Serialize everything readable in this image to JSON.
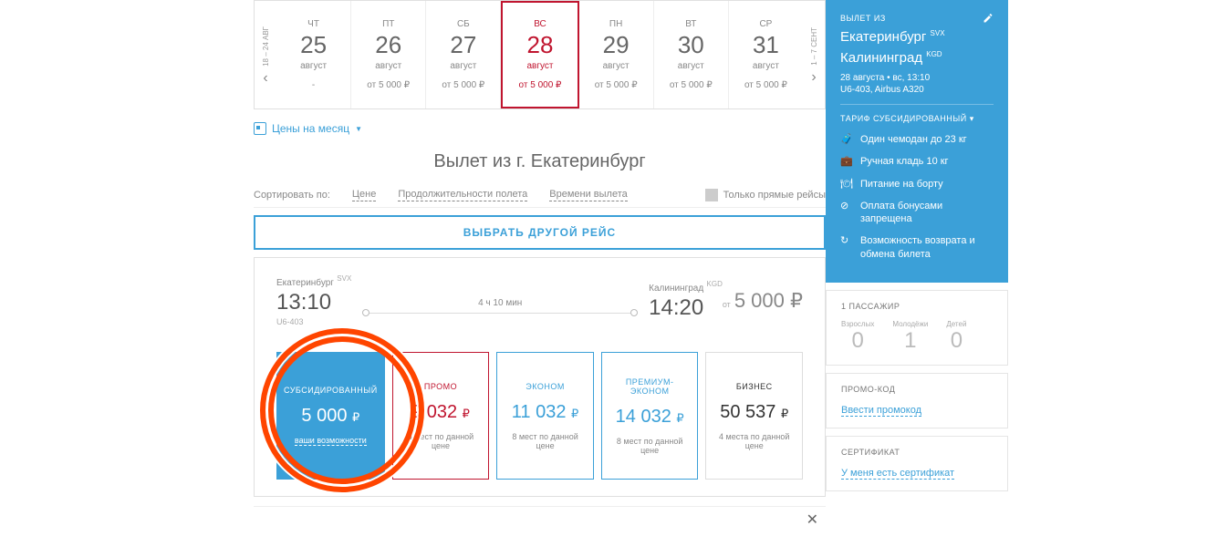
{
  "dateNav": {
    "prevRange": "18 – 24 АВГ",
    "nextRange": "1 – 7 СЕНТ"
  },
  "days": [
    {
      "dow": "ЧТ",
      "num": "25",
      "month": "август",
      "price": "-",
      "active": false
    },
    {
      "dow": "ПТ",
      "num": "26",
      "month": "август",
      "price": "от 5 000 ₽",
      "active": false
    },
    {
      "dow": "СБ",
      "num": "27",
      "month": "август",
      "price": "от 5 000 ₽",
      "active": false
    },
    {
      "dow": "ВС",
      "num": "28",
      "month": "август",
      "price": "от 5 000 ₽",
      "active": true
    },
    {
      "dow": "ПН",
      "num": "29",
      "month": "август",
      "price": "от 5 000 ₽",
      "active": false
    },
    {
      "dow": "ВТ",
      "num": "30",
      "month": "август",
      "price": "от 5 000 ₽",
      "active": false
    },
    {
      "dow": "СР",
      "num": "31",
      "month": "август",
      "price": "от 5 000 ₽",
      "active": false
    }
  ],
  "monthPricesLink": "Цены на месяц",
  "heading": "Вылет из г. Екатеринбург",
  "sort": {
    "label": "Сортировать по:",
    "opts": [
      "Цене",
      "Продолжительности полета",
      "Времени вылета"
    ],
    "direct": "Только прямые рейсы"
  },
  "chooseAnother": "ВЫБРАТЬ ДРУГОЙ РЕЙС",
  "flight": {
    "dep": {
      "city": "Екатеринбург",
      "code": "SVX",
      "time": "13:10",
      "flightNo": "U6-403"
    },
    "arr": {
      "city": "Калининград",
      "code": "KGD",
      "time": "14:20"
    },
    "duration": "4 ч 10 мин",
    "fromLabel": "от",
    "fromPrice": "5 000",
    "rub": "₽"
  },
  "fares": [
    {
      "cls": "sub",
      "name": "СУБСИДИРОВАННЫЙ",
      "price": "5 000",
      "seats": "ваши возможности"
    },
    {
      "cls": "promo",
      "name": "ПРОМО",
      "price": "9 032",
      "seats": "8 мест по данной цене"
    },
    {
      "cls": "econ",
      "name": "ЭКОНОМ",
      "price": "11 032",
      "seats": "8 мест по данной цене"
    },
    {
      "cls": "prem",
      "name": "ПРЕМИУМ-ЭКОНОМ",
      "price": "14 032",
      "seats": "8 мест по данной цене"
    },
    {
      "cls": "biz",
      "name": "БИЗНЕС",
      "price": "50 537",
      "seats": "4 места по данной цене"
    }
  ],
  "sidebar": {
    "departLabel": "ВЫЛЕТ ИЗ",
    "fromCity": "Екатеринбург",
    "fromCode": "SVX",
    "toCity": "Калининград",
    "toCode": "KGD",
    "dateTime": "28 августа • вс, 13:10",
    "flightInfo": "U6-403, Airbus A320",
    "tariffHead": "ТАРИФ СУБСИДИРОВАННЫЙ ▾",
    "features": [
      "Один чемодан до 23 кг",
      "Ручная кладь 10 кг",
      "Питание на борту",
      "Оплата бонусами запрещена",
      "Возможность возврата и обмена билета"
    ],
    "paxLabel": "1 ПАССАЖИР",
    "pax": [
      {
        "lbl": "Взрослых",
        "n": "0"
      },
      {
        "lbl": "Молодёжи",
        "n": "1"
      },
      {
        "lbl": "Детей",
        "n": "0"
      }
    ],
    "promoLabel": "ПРОМО-КОД",
    "promoLink": "Ввести промокод",
    "certLabel": "СЕРТИФИКАТ",
    "certLink": "У меня есть сертификат"
  }
}
